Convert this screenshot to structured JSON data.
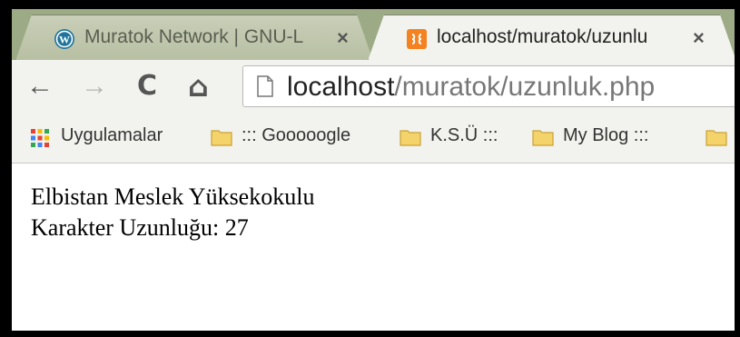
{
  "tabs": [
    {
      "title": "Muratok Network | GNU-L",
      "icon": "wordpress-icon",
      "active": false
    },
    {
      "title": "localhost/muratok/uzunlu",
      "icon": "xampp-icon",
      "active": true
    }
  ],
  "tab_close_glyph": "×",
  "toolbar": {
    "back_glyph": "←",
    "forward_glyph": "→",
    "reload_glyph": "C",
    "home_glyph": "⌂"
  },
  "address": {
    "host": "localhost",
    "path": "/muratok/uzunluk.php"
  },
  "bookmarks": [
    {
      "label": "Uygulamalar",
      "icon": "apps-grid-icon"
    },
    {
      "label": "::: Gooooogle",
      "icon": "folder-icon"
    },
    {
      "label": "K.S.Ü :::",
      "icon": "folder-icon"
    },
    {
      "label": "My Blog :::",
      "icon": "folder-icon"
    }
  ],
  "page": {
    "line1": "Elbistan Meslek Yüksekokulu",
    "line2": "Karakter Uzunluğu: 27"
  },
  "colors": {
    "tabstrip": "#9daa86",
    "toolbar": "#f2f3ee",
    "xampp_orange": "#f58220",
    "wordpress_blue": "#21759b",
    "folder_yellow": "#f5d36b"
  }
}
